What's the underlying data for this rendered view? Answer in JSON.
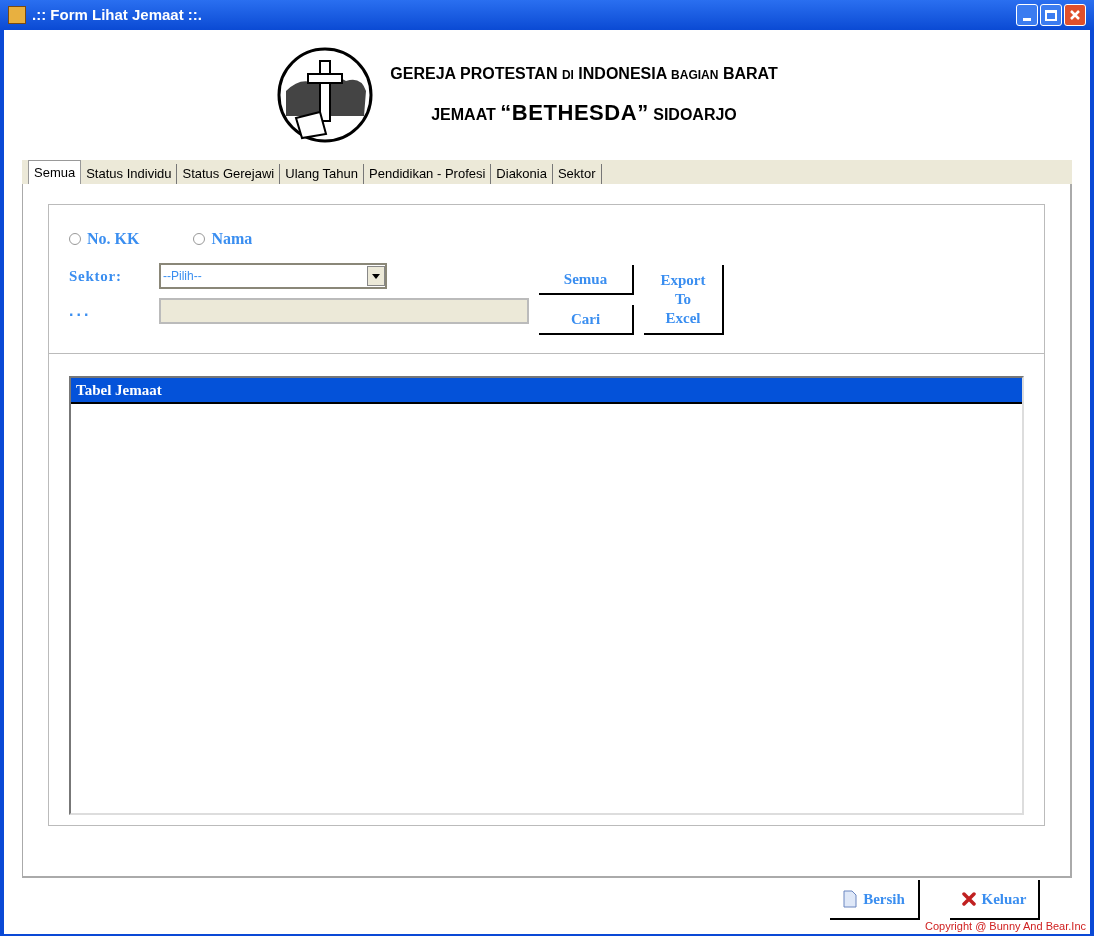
{
  "window": {
    "title": ".:: Form Lihat Jemaat ::."
  },
  "header": {
    "lines": [
      [
        {
          "text": "GEREJA PROTESTAN ",
          "small": false,
          "large": false
        },
        {
          "text": "DI",
          "small": true,
          "large": false
        },
        {
          "text": " INDONESIA ",
          "small": false,
          "large": false
        },
        {
          "text": "BAGIAN",
          "small": true,
          "large": false
        },
        {
          "text": " BARAT",
          "small": false,
          "large": false
        }
      ],
      [
        {
          "text": "JEMAAT ",
          "small": false,
          "large": false
        },
        {
          "text": "“BETHESDA”",
          "small": false,
          "large": true
        },
        {
          "text": " SIDOARJO",
          "small": false,
          "large": false
        }
      ]
    ]
  },
  "tabs": [
    {
      "label": "Semua",
      "selected": true
    },
    {
      "label": "Status Individu",
      "selected": false
    },
    {
      "label": "Status Gerejawi",
      "selected": false
    },
    {
      "label": "Ulang Tahun",
      "selected": false
    },
    {
      "label": "Pendidikan - Profesi",
      "selected": false
    },
    {
      "label": "Diakonia",
      "selected": false
    },
    {
      "label": "Sektor",
      "selected": false
    }
  ],
  "search": {
    "radios": [
      {
        "label": "No. KK",
        "selected": false
      },
      {
        "label": "Nama",
        "selected": false
      }
    ],
    "sektor_label": "Sektor:",
    "sektor_value": "--Pilih--",
    "text_label": "...",
    "buttons": [
      "Semua",
      "Cari"
    ],
    "export_button": "Export To Excel"
  },
  "table": {
    "title": "Tabel Jemaat"
  },
  "footer": {
    "buttons": [
      {
        "label": "Bersih",
        "kind": "page"
      },
      {
        "label": "Keluar",
        "kind": "close"
      }
    ],
    "copyright": "Copyright @ Bunny And Bear.Inc"
  }
}
